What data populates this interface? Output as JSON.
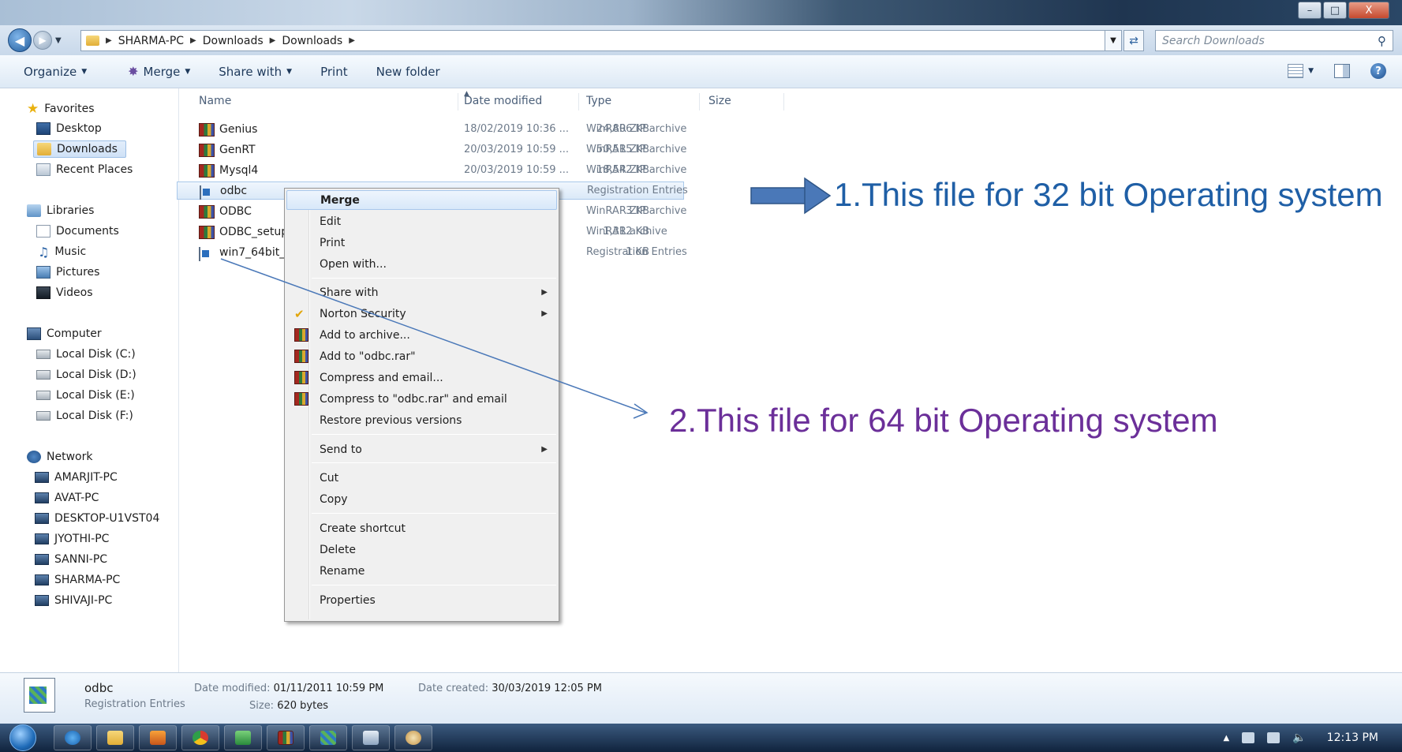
{
  "window": {
    "controls": {
      "minimize": "–",
      "maximize": "□",
      "close": "X"
    }
  },
  "address": {
    "breadcrumb": [
      "SHARMA-PC",
      "Downloads",
      "Downloads"
    ],
    "search_placeholder": "Search Downloads"
  },
  "toolbar": {
    "organize": "Organize",
    "merge": "Merge",
    "share_with": "Share with",
    "print": "Print",
    "new_folder": "New folder"
  },
  "nav": {
    "favorites": "Favorites",
    "desktop": "Desktop",
    "downloads": "Downloads",
    "recent_places": "Recent Places",
    "libraries": "Libraries",
    "documents": "Documents",
    "music": "Music",
    "pictures": "Pictures",
    "videos": "Videos",
    "computer": "Computer",
    "disk_c": "Local Disk (C:)",
    "disk_d": "Local Disk (D:)",
    "disk_e": "Local Disk (E:)",
    "disk_f": "Local Disk (F:)",
    "network": "Network",
    "pcs": [
      "AMARJIT-PC",
      "AVAT-PC",
      "DESKTOP-U1VST04",
      "JYOTHI-PC",
      "SANNI-PC",
      "SHARMA-PC",
      "SHIVAJI-PC"
    ]
  },
  "columns": {
    "name": "Name",
    "date": "Date modified",
    "type": "Type",
    "size": "Size"
  },
  "files": [
    {
      "name": "Genius",
      "date": "18/02/2019 10:36 ...",
      "type": "WinRAR ZIP archive",
      "size": "24,806 KB",
      "icon": "rar"
    },
    {
      "name": "GenRT",
      "date": "20/03/2019 10:59 ...",
      "type": "WinRAR ZIP archive",
      "size": "50,515 KB",
      "icon": "rar"
    },
    {
      "name": "Mysql4",
      "date": "20/03/2019 10:59 ...",
      "type": "WinRAR ZIP archive",
      "size": "18,542 KB",
      "icon": "rar"
    },
    {
      "name": "odbc",
      "date": "",
      "type": "Registration Entries",
      "size": "",
      "icon": "reg",
      "selected": true
    },
    {
      "name": "ODBC",
      "date": "",
      "type": "WinRAR ZIP archive",
      "size": "3 KB",
      "icon": "rar"
    },
    {
      "name": "ODBC_setup",
      "date": "",
      "type": "WinRAR archive",
      "size": "1,312 KB",
      "icon": "rar"
    },
    {
      "name": "win7_64bit_",
      "date": "",
      "type": "Registration Entries",
      "size": "1 KB",
      "icon": "reg"
    }
  ],
  "context_menu": {
    "merge": "Merge",
    "edit": "Edit",
    "print": "Print",
    "open_with": "Open with...",
    "share_with": "Share with",
    "norton": "Norton Security",
    "add_archive": "Add to archive...",
    "add_rar": "Add to \"odbc.rar\"",
    "compress_email": "Compress and email...",
    "compress_rar_email": "Compress to \"odbc.rar\" and email",
    "restore": "Restore previous versions",
    "send_to": "Send to",
    "cut": "Cut",
    "copy": "Copy",
    "create_shortcut": "Create shortcut",
    "delete": "Delete",
    "rename": "Rename",
    "properties": "Properties"
  },
  "annotations": {
    "note1": "1.This file for 32 bit Operating system",
    "note2": "2.This file for 64 bit Operating system"
  },
  "details": {
    "name": "odbc",
    "type": "Registration Entries",
    "date_modified_label": "Date modified:",
    "date_modified": "01/11/2011 10:59 PM",
    "date_created_label": "Date created:",
    "date_created": "30/03/2019 12:05 PM",
    "size_label": "Size:",
    "size": "620 bytes"
  },
  "taskbar": {
    "clock": "12:13 PM"
  },
  "colors": {
    "note1": "#1f5fa6",
    "note2": "#6b2f99",
    "arrow": "#4a78b8"
  }
}
